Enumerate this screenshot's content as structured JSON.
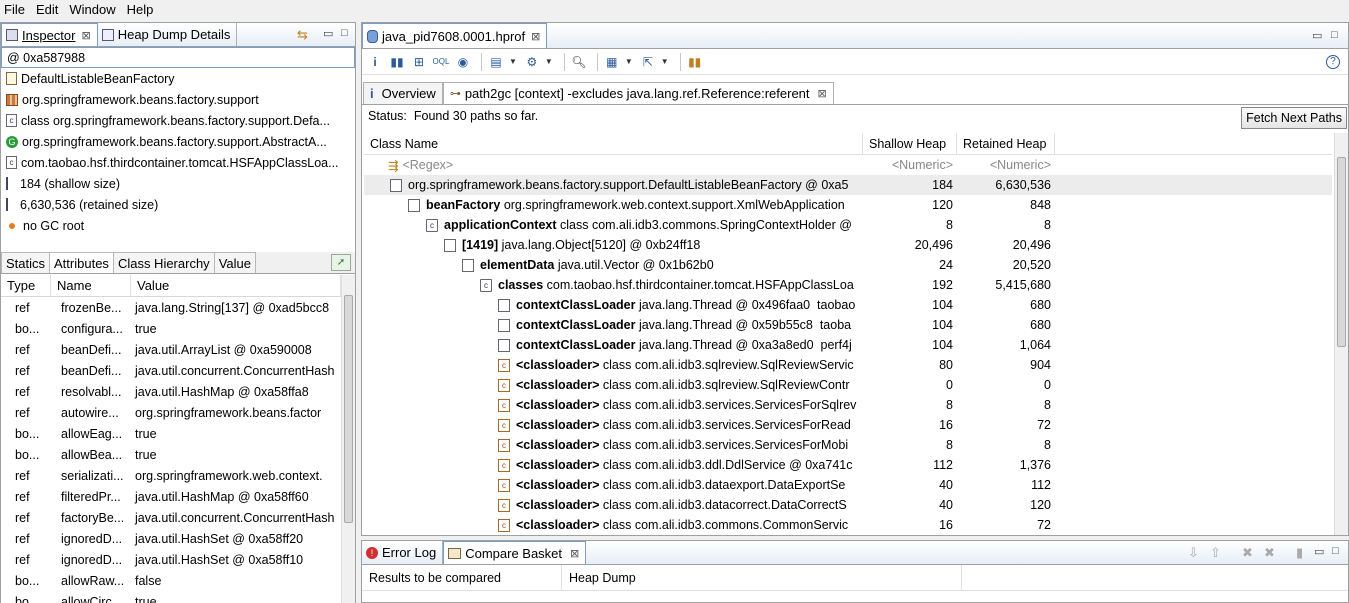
{
  "menu": [
    "File",
    "Edit",
    "Window",
    "Help"
  ],
  "left": {
    "tabs": [
      {
        "label": "Inspector",
        "active": true
      },
      {
        "label": "Heap Dump Details",
        "active": false
      }
    ],
    "inspector_rows": [
      {
        "icon": "at",
        "text": "@ 0xa587988"
      },
      {
        "icon": "doc",
        "text": "DefaultListableBeanFactory"
      },
      {
        "icon": "package",
        "text": "org.springframework.beans.factory.support"
      },
      {
        "icon": "class",
        "text": "class org.springframework.beans.factory.support.Defa..."
      },
      {
        "icon": "gc",
        "text": "org.springframework.beans.factory.support.AbstractA..."
      },
      {
        "icon": "class",
        "text": "com.taobao.hsf.thirdcontainer.tomcat.HSFAppClassLoa..."
      },
      {
        "icon": "size",
        "text": "184 (shallow size)"
      },
      {
        "icon": "size",
        "text": "6,630,536 (retained size)"
      },
      {
        "icon": "dot",
        "text": "no GC root"
      }
    ],
    "subtabs": [
      "Statics",
      "Attributes",
      "Class Hierarchy",
      "Value"
    ],
    "attr_columns": [
      "Type",
      "Name",
      "Value"
    ],
    "attributes": [
      [
        "ref",
        "frozenBe...",
        "java.lang.String[137] @ 0xad5bcc8"
      ],
      [
        "bo...",
        "configura...",
        "true"
      ],
      [
        "ref",
        "beanDefi...",
        "java.util.ArrayList @ 0xa590008"
      ],
      [
        "ref",
        "beanDefi...",
        "java.util.concurrent.ConcurrentHash"
      ],
      [
        "ref",
        "resolvabl...",
        "java.util.HashMap @ 0xa58ffa8"
      ],
      [
        "ref",
        "autowire...",
        "org.springframework.beans.factor"
      ],
      [
        "bo...",
        "allowEag...",
        "true"
      ],
      [
        "bo...",
        "allowBea...",
        "true"
      ],
      [
        "ref",
        "serializati...",
        "org.springframework.web.context."
      ],
      [
        "ref",
        "filteredPr...",
        "java.util.HashMap @ 0xa58ff60"
      ],
      [
        "ref",
        "factoryBe...",
        "java.util.concurrent.ConcurrentHash"
      ],
      [
        "ref",
        "ignoredD...",
        "java.util.HashSet @ 0xa58ff20"
      ],
      [
        "ref",
        "ignoredD...",
        "java.util.HashSet @ 0xa58ff10"
      ],
      [
        "bo...",
        "allowRaw...",
        "false"
      ],
      [
        "bo...",
        "allowCirc...",
        "true"
      ]
    ]
  },
  "editor": {
    "tab_label": "java_pid7608.0001.hprof",
    "inner_tabs": [
      {
        "label": "Overview",
        "active": false
      },
      {
        "label": "path2gc [context] -excludes java.lang.ref.Reference:referent",
        "active": true
      }
    ],
    "status_label": "Status:",
    "status_text": "Found 30 paths so far.",
    "fetch_button": "Fetch Next Paths",
    "columns": [
      "Class Name",
      "Shallow Heap",
      "Retained Heap"
    ],
    "filter_row": {
      "name": "<Regex>",
      "shallow": "<Numeric>",
      "retained": "<Numeric>"
    },
    "rows": [
      {
        "indent": 0,
        "icon": "doc",
        "bold": "",
        "rest": "org.springframework.beans.factory.support.DefaultListableBeanFactory @ 0xa5",
        "shallow": "184",
        "retained": "6,630,536",
        "highlight": true
      },
      {
        "indent": 1,
        "icon": "doc",
        "bold": "beanFactory",
        "rest": " org.springframework.web.context.support.XmlWebApplication",
        "shallow": "120",
        "retained": "848"
      },
      {
        "indent": 2,
        "icon": "class",
        "bold": "applicationContext",
        "rest": " class com.ali.idb3.commons.SpringContextHolder @",
        "shallow": "8",
        "retained": "8"
      },
      {
        "indent": 3,
        "icon": "doc",
        "bold": "[1419]",
        "rest": " java.lang.Object[5120] @ 0xb24ff18",
        "shallow": "20,496",
        "retained": "20,496"
      },
      {
        "indent": 4,
        "icon": "doc",
        "bold": "elementData",
        "rest": " java.util.Vector @ 0x1b62b0",
        "shallow": "24",
        "retained": "20,520"
      },
      {
        "indent": 5,
        "icon": "class",
        "bold": "classes",
        "rest": " com.taobao.hsf.thirdcontainer.tomcat.HSFAppClassLoa",
        "shallow": "192",
        "retained": "5,415,680"
      },
      {
        "indent": 6,
        "icon": "doc",
        "bold": "contextClassLoader",
        "rest": " java.lang.Thread @ 0x496faa0  taobao",
        "shallow": "104",
        "retained": "680"
      },
      {
        "indent": 6,
        "icon": "doc",
        "bold": "contextClassLoader",
        "rest": " java.lang.Thread @ 0x59b55c8  taoba",
        "shallow": "104",
        "retained": "680"
      },
      {
        "indent": 6,
        "icon": "doc",
        "bold": "contextClassLoader",
        "rest": " java.lang.Thread @ 0xa3a8ed0  perf4j",
        "shallow": "104",
        "retained": "1,064"
      },
      {
        "indent": 6,
        "icon": "classloader",
        "bold": "<classloader>",
        "rest": " class com.ali.idb3.sqlreview.SqlReviewServic",
        "shallow": "80",
        "retained": "904"
      },
      {
        "indent": 6,
        "icon": "classloader",
        "bold": "<classloader>",
        "rest": " class com.ali.idb3.sqlreview.SqlReviewContr",
        "shallow": "0",
        "retained": "0"
      },
      {
        "indent": 6,
        "icon": "classloader",
        "bold": "<classloader>",
        "rest": " class com.ali.idb3.services.ServicesForSqlrev",
        "shallow": "8",
        "retained": "8"
      },
      {
        "indent": 6,
        "icon": "classloader",
        "bold": "<classloader>",
        "rest": " class com.ali.idb3.services.ServicesForRead",
        "shallow": "16",
        "retained": "72"
      },
      {
        "indent": 6,
        "icon": "classloader",
        "bold": "<classloader>",
        "rest": " class com.ali.idb3.services.ServicesForMobi",
        "shallow": "8",
        "retained": "8"
      },
      {
        "indent": 6,
        "icon": "classloader",
        "bold": "<classloader>",
        "rest": " class com.ali.idb3.ddl.DdlService @ 0xa741c",
        "shallow": "112",
        "retained": "1,376"
      },
      {
        "indent": 6,
        "icon": "classloader",
        "bold": "<classloader>",
        "rest": " class com.ali.idb3.dataexport.DataExportSe",
        "shallow": "40",
        "retained": "112"
      },
      {
        "indent": 6,
        "icon": "classloader",
        "bold": "<classloader>",
        "rest": " class com.ali.idb3.datacorrect.DataCorrectS",
        "shallow": "40",
        "retained": "120"
      },
      {
        "indent": 6,
        "icon": "classloader",
        "bold": "<classloader>",
        "rest": " class com.ali.idb3.commons.CommonServic",
        "shallow": "16",
        "retained": "72"
      }
    ]
  },
  "bottom": {
    "tabs": [
      {
        "label": "Error Log",
        "active": false
      },
      {
        "label": "Compare Basket",
        "active": true
      }
    ],
    "columns": [
      "Results to be compared",
      "Heap Dump"
    ]
  }
}
